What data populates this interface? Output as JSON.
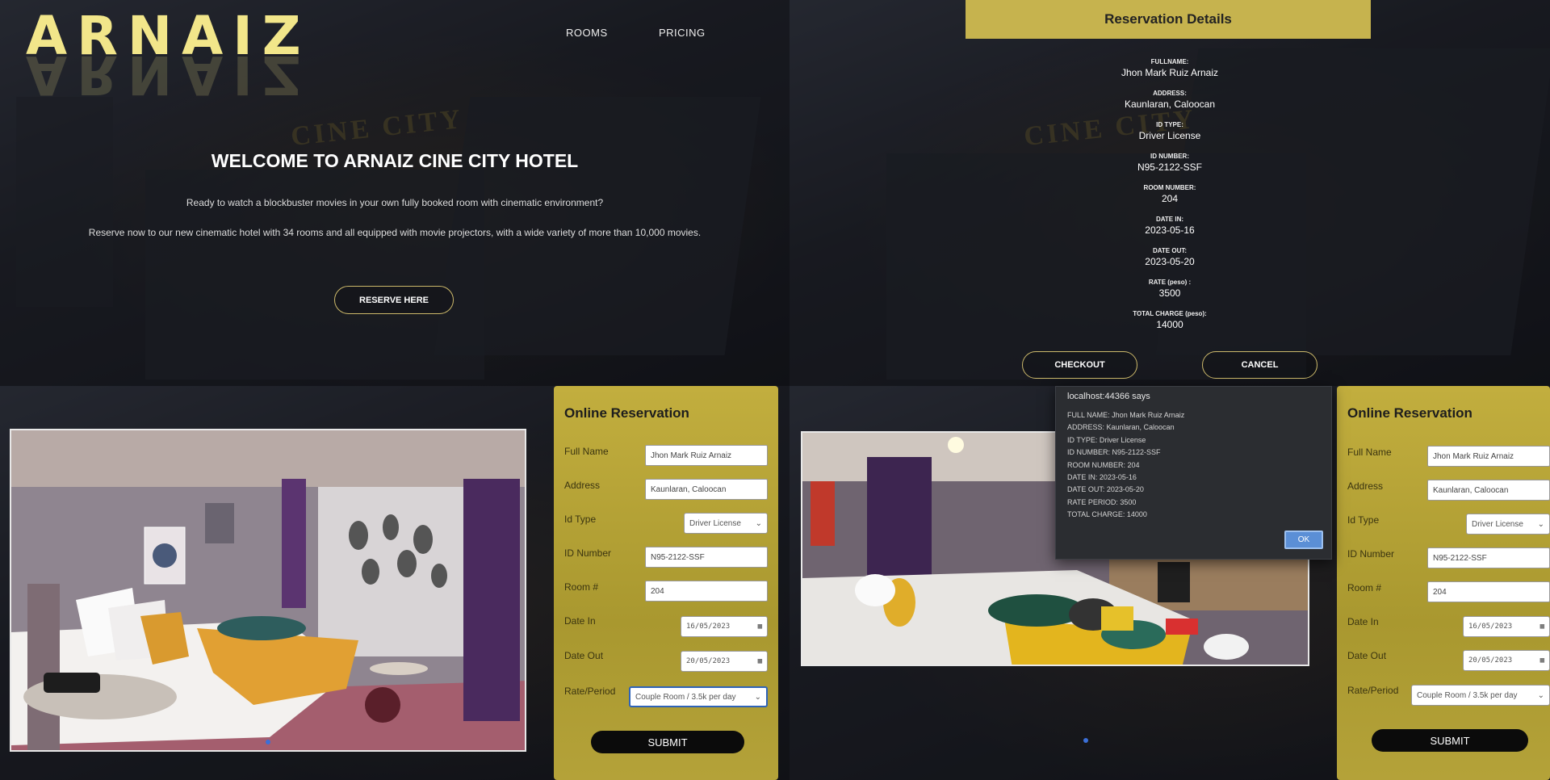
{
  "landing": {
    "logo": "ARNAIZ",
    "nav": [
      "ROOMS",
      "PRICING"
    ],
    "headline": "WELCOME TO ARNAIZ CINE CITY HOTEL",
    "paragraph1": "Ready to watch a blockbuster movies in your own fully booked room with cinematic environment?",
    "paragraph2": "Reserve now to our new cinematic hotel with 34 rooms and all equipped with movie projectors, with a wide variety of more than 10,000 movies.",
    "reserve_button": "RESERVE HERE",
    "sign_text": "CINE CITY"
  },
  "reservation_details": {
    "title": "Reservation Details",
    "items": [
      {
        "label": "FULLNAME:",
        "value": "Jhon Mark Ruiz Arnaiz"
      },
      {
        "label": "ADDRESS:",
        "value": "Kaunlaran, Caloocan"
      },
      {
        "label": "ID TYPE:",
        "value": "Driver License"
      },
      {
        "label": "ID NUMBER:",
        "value": "N95-2122-SSF"
      },
      {
        "label": "ROOM NUMBER:",
        "value": "204"
      },
      {
        "label": "DATE IN:",
        "value": "2023-05-16"
      },
      {
        "label": "DATE OUT:",
        "value": "2023-05-20"
      },
      {
        "label": "RATE (peso) :",
        "value": "3500"
      },
      {
        "label": "TOTAL CHARGE (peso):",
        "value": "14000"
      }
    ],
    "checkout_button": "CHECKOUT",
    "cancel_button": "CANCEL"
  },
  "form": {
    "title": "Online Reservation",
    "labels": {
      "full_name": "Full Name",
      "address": "Address",
      "id_type": "Id Type",
      "id_number": "ID Number",
      "room": "Room #",
      "date_in": "Date In",
      "date_out": "Date Out",
      "rate": "Rate/Period"
    },
    "values": {
      "full_name": "Jhon Mark Ruiz Arnaiz",
      "address": "Kaunlaran, Caloocan",
      "id_type": "Driver License",
      "id_number": "N95-2122-SSF",
      "room": "204",
      "date_in": "16/05/2023",
      "date_out": "20/05/2023",
      "rate": "Couple Room / 3.5k per day"
    },
    "submit_button": "SUBMIT"
  },
  "dialog": {
    "title": "localhost:44366 says",
    "lines": [
      "FULL NAME: Jhon Mark Ruiz Arnaiz",
      "ADDRESS: Kaunlaran, Caloocan",
      "ID TYPE: Driver License",
      "ID NUMBER: N95-2122-SSF",
      "ROOM NUMBER: 204",
      "DATE IN: 2023-05-16",
      "DATE OUT: 2023-05-20",
      "RATE PERIOD: 3500",
      "TOTAL CHARGE: 14000"
    ],
    "ok_button": "OK"
  },
  "colors": {
    "gold": "#c6b34e",
    "logo": "#f2e68a",
    "dialog_bg": "#2b2d31",
    "ok_button": "#5b8fd6"
  }
}
